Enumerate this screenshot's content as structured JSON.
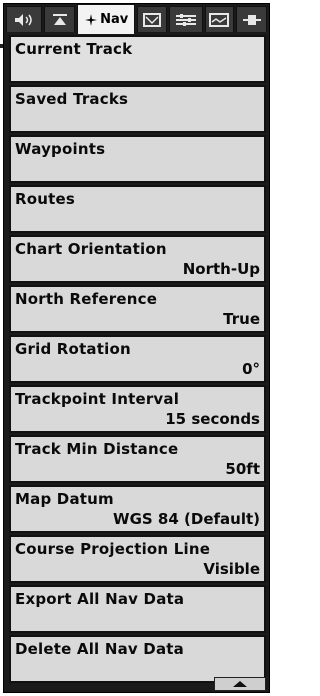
{
  "tabs": [
    {
      "icon": "speaker-icon",
      "label": ""
    },
    {
      "icon": "sonar-icon",
      "label": ""
    },
    {
      "icon": "nav-compass-icon",
      "label": "Nav",
      "active": true
    },
    {
      "icon": "chart-icon",
      "label": ""
    },
    {
      "icon": "settings-sliders-icon",
      "label": ""
    },
    {
      "icon": "sonar-screen-icon",
      "label": ""
    },
    {
      "icon": "accessory-icon",
      "label": ""
    }
  ],
  "menu": [
    {
      "label": "Current Track",
      "value": ""
    },
    {
      "label": "Saved Tracks",
      "value": ""
    },
    {
      "label": "Waypoints",
      "value": ""
    },
    {
      "label": "Routes",
      "value": ""
    },
    {
      "label": "Chart Orientation",
      "value": "North-Up"
    },
    {
      "label": "North Reference",
      "value": "True"
    },
    {
      "label": "Grid Rotation",
      "value": "0°"
    },
    {
      "label": "Trackpoint Interval",
      "value": "15 seconds"
    },
    {
      "label": "Track Min Distance",
      "value": "50ft"
    },
    {
      "label": "Map Datum",
      "value": "WGS 84 (Default)"
    },
    {
      "label": "Course Projection Line",
      "value": "Visible"
    },
    {
      "label": "Export All Nav Data",
      "value": ""
    },
    {
      "label": "Delete All Nav Data",
      "value": ""
    }
  ],
  "scroll": {
    "icon": "scroll-up-arrow-icon"
  }
}
